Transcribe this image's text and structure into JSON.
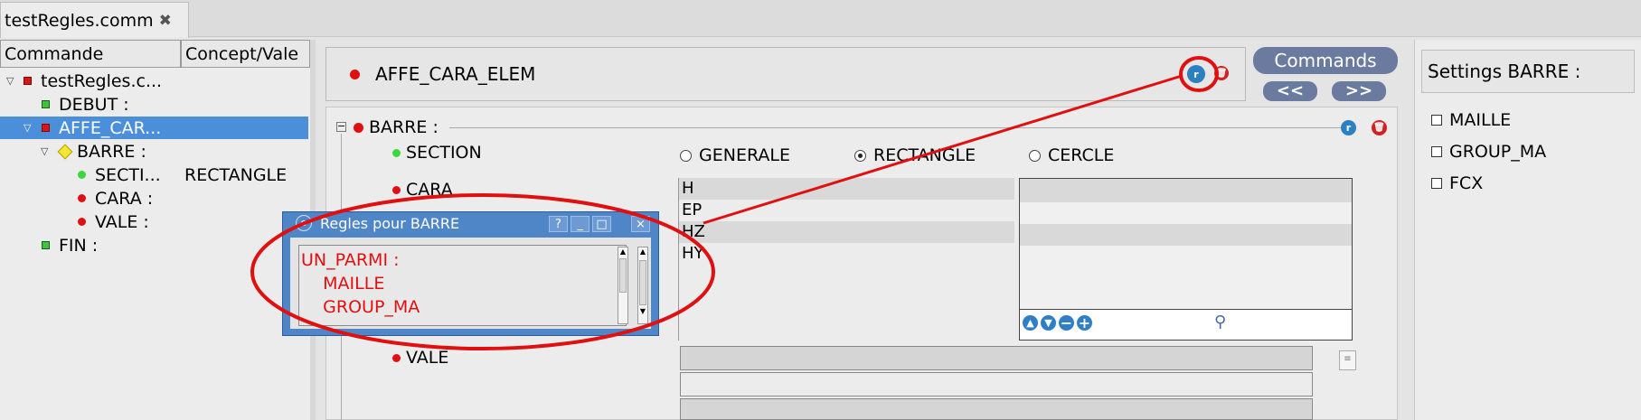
{
  "tab": {
    "title": "testRegles.comm",
    "close_icon": "✖"
  },
  "tree": {
    "headers": [
      "Commande",
      "Concept/Vale"
    ],
    "items": [
      {
        "label": "testRegles.c..."
      },
      {
        "label": "DEBUT :"
      },
      {
        "label": "AFFE_CAR..."
      },
      {
        "label": "BARRE :"
      },
      {
        "label": "SECTI...",
        "value": "RECTANGLE"
      },
      {
        "label": "CARA :"
      },
      {
        "label": "VALE :"
      },
      {
        "label": "FIN :"
      }
    ]
  },
  "command": {
    "name": "AFFE_CARA_ELEM"
  },
  "commands_button": "Commands",
  "nav": {
    "prev": "<<",
    "next": ">>"
  },
  "form": {
    "group_label": "BARRE :",
    "section_label": "SECTION",
    "section_options": [
      "GENERALE",
      "RECTANGLE",
      "CERCLE"
    ],
    "section_selected": "RECTANGLE",
    "cara_label": "CARA",
    "cara_items": [
      "H",
      "EP",
      "HZ",
      "HY"
    ],
    "vale_label": "VALE"
  },
  "dialog": {
    "title": "Regles pour BARRE",
    "rules": [
      "UN_PARMI :",
      "    MAILLE",
      "    GROUP_MA"
    ],
    "buttons": [
      "?",
      "_",
      "□",
      "×"
    ]
  },
  "settings": {
    "title": "Settings BARRE :",
    "options": [
      "MAILLE",
      "GROUP_MA",
      "FCX"
    ]
  },
  "colors": {
    "accent": "#6b7ba0",
    "selection": "#4b8fdb",
    "annotation": "#e01010",
    "dialog": "#4f86c8"
  }
}
